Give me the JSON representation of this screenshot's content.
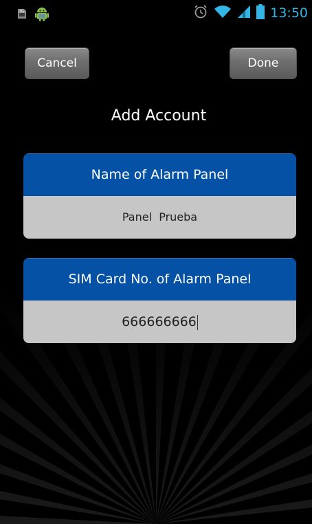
{
  "status_bar": {
    "time": "13:50",
    "icons": [
      "sim-icon",
      "android-icon",
      "alarm-clock-icon",
      "wifi-icon",
      "signal-icon",
      "battery-icon"
    ]
  },
  "toolbar": {
    "cancel_label": "Cancel",
    "done_label": "Done"
  },
  "page_title": "Add Account",
  "form": {
    "panel_name": {
      "label": "Name of Alarm Panel",
      "value": "Panel  Prueba"
    },
    "sim_number": {
      "label": "SIM Card No. of Alarm Panel",
      "value": "666666666"
    }
  },
  "colors": {
    "accent_blue": "#0451a5",
    "status_time": "#33b5e5",
    "field_bg": "#c6c6c6"
  }
}
